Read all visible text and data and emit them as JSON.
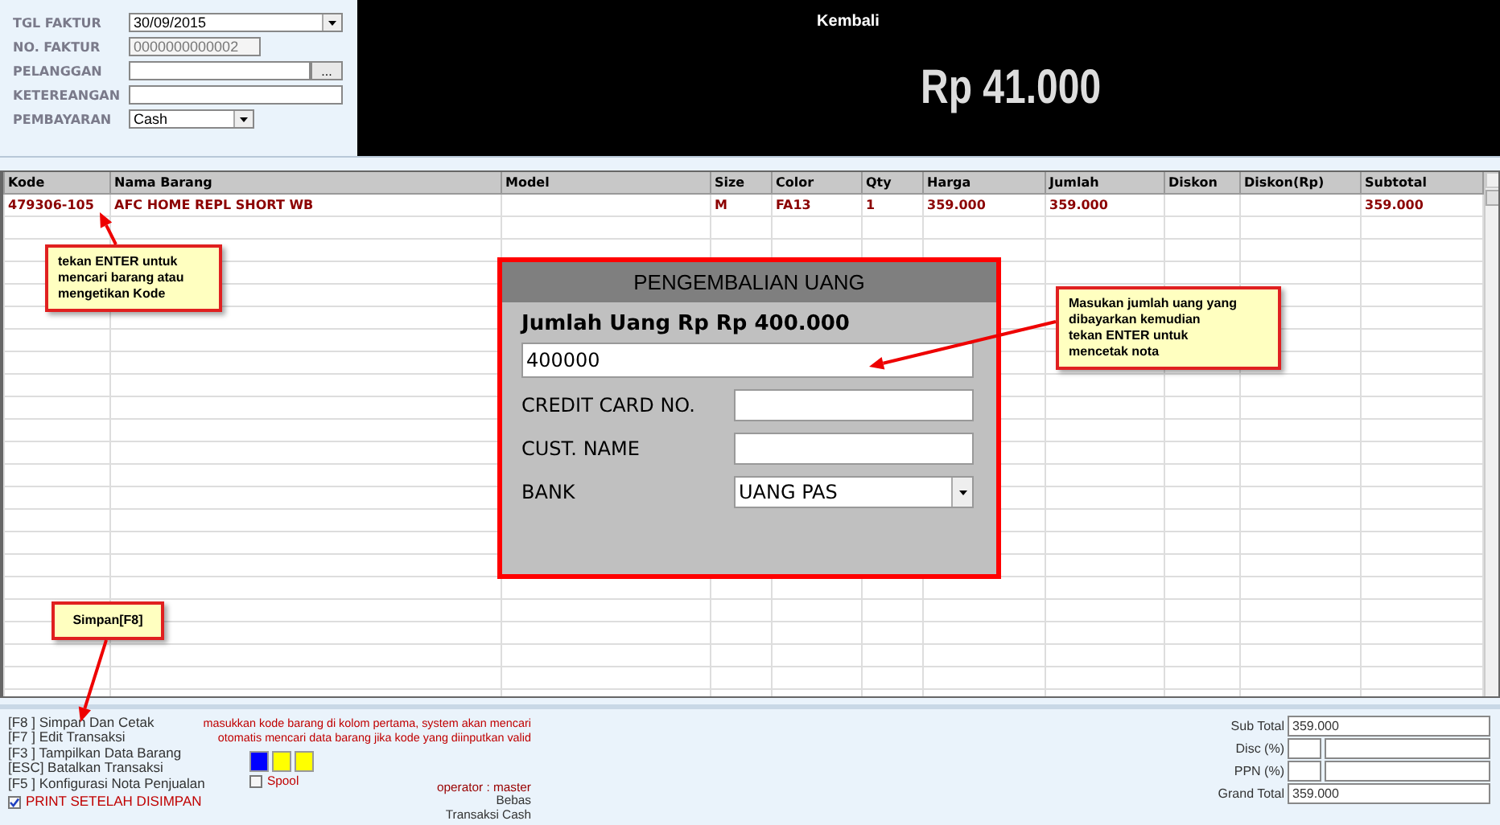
{
  "header_form": {
    "fields": [
      {
        "label": "TGL FAKTUR",
        "value": "30/09/2015",
        "kind": "dropdown"
      },
      {
        "label": "NO. FAKTUR",
        "value": "0000000000002",
        "kind": "readonly"
      },
      {
        "label": "PELANGGAN",
        "kind": "browse",
        "button": "..."
      },
      {
        "label": "KETEREANGAN",
        "kind": "text"
      },
      {
        "label": "PEMBAYARAN",
        "value": "Cash",
        "kind": "dropdown"
      }
    ]
  },
  "change_panel": {
    "title": "Kembali",
    "amount": "Rp 41.000"
  },
  "table": {
    "columns": [
      "Kode",
      "Nama Barang",
      "Model",
      "Size",
      "Color",
      "Qty",
      "Harga",
      "Jumlah",
      "Diskon",
      "Diskon(Rp)",
      "Subtotal"
    ],
    "rows": [
      [
        "479306-105",
        "AFC HOME  REPL SHORT WB",
        "",
        "M",
        "FA13",
        "1",
        "359.000",
        "359.000",
        "",
        "",
        "359.000"
      ]
    ]
  },
  "dialog": {
    "title": "PENGEMBALIAN UANG",
    "amount_label": "Jumlah Uang Rp Rp 400.000",
    "amount_value": "400000",
    "fields": [
      {
        "label": "CREDIT CARD NO.",
        "kind": "text"
      },
      {
        "label": "CUST. NAME",
        "kind": "text"
      },
      {
        "label": "BANK",
        "value": "UANG PAS",
        "kind": "dropdown"
      }
    ]
  },
  "callouts": [
    {
      "text": "tekan ENTER untuk\nmencari barang atau\nmengetikan Kode"
    },
    {
      "text": "Masukan jumlah uang yang\ndibayarkan kemudian\ntekan ENTER untuk\nmencetak nota"
    },
    {
      "text": "Simpan[F8]"
    }
  ],
  "footer": {
    "shortcuts": [
      "[F8 ] Simpan Dan Cetak",
      "[F7 ] Edit Transaksi",
      "[F3 ] Tampilkan Data Barang",
      "[ESC] Batalkan Transaksi",
      "[F5 ] Konfigurasi Nota Penjualan"
    ],
    "print_checkbox": {
      "label": "PRINT SETELAH DISIMPAN",
      "checked": true
    },
    "hint": "masukkan kode barang di kolom pertama, system akan mencari\notomatis mencari data barang jika kode yang diinputkan valid",
    "swatches": [
      {
        "color": "#0000ff"
      },
      {
        "color": "#ffff00"
      },
      {
        "color": "#ffff00"
      }
    ],
    "spool_checkbox": {
      "label": "Spool",
      "checked": false
    },
    "operator": "operator : master",
    "status_lines": [
      "Bebas",
      "Transaksi Cash"
    ],
    "totals": [
      {
        "label": "Sub Total",
        "value": "359.000",
        "kind": "single"
      },
      {
        "label": "Disc (%)",
        "kind": "split"
      },
      {
        "label": "PPN (%)",
        "kind": "split"
      },
      {
        "label": "Grand Total",
        "value": "359.000",
        "kind": "single"
      }
    ]
  }
}
